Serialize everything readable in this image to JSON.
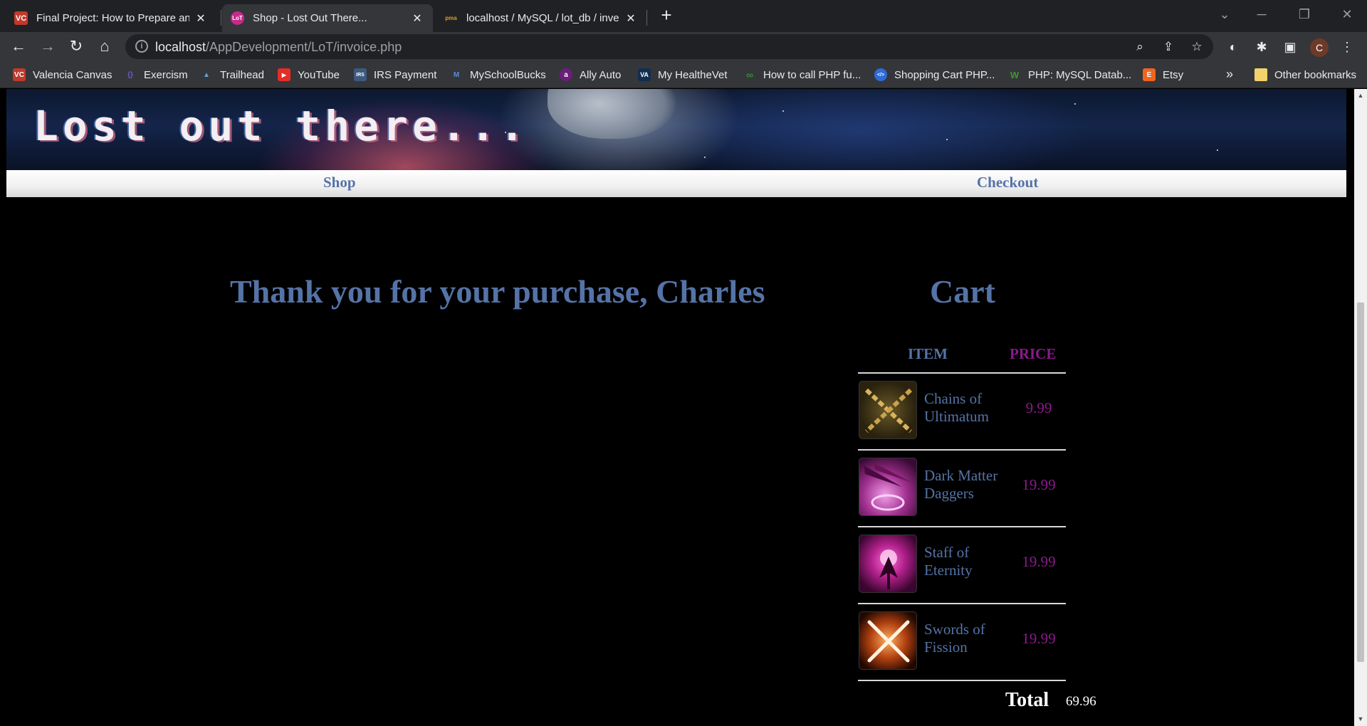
{
  "browser": {
    "tabs": [
      {
        "title": "Final Project: How to Prepare and",
        "favicon": "VC"
      },
      {
        "title": "Shop - Lost Out There...",
        "favicon": "LoT"
      },
      {
        "title": "localhost / MySQL / lot_db / inve",
        "favicon": "pma"
      }
    ],
    "url_host": "localhost",
    "url_path": "/AppDevelopment/LoT/invoice.php",
    "profile_initial": "C",
    "bookmarks": [
      {
        "label": "Valencia Canvas",
        "icon": "VC",
        "color": "#c0392b"
      },
      {
        "label": "Exercism",
        "icon": "{}",
        "color": "#3d2a8a"
      },
      {
        "label": "Trailhead",
        "icon": "▲",
        "color": "#1b73b8"
      },
      {
        "label": "YouTube",
        "icon": "▶",
        "color": "#e52d27"
      },
      {
        "label": "IRS Payment",
        "icon": "IRS",
        "color": "#3d5a80"
      },
      {
        "label": "MySchoolBucks",
        "icon": "M",
        "color": "#2a4d9b"
      },
      {
        "label": "Ally Auto",
        "icon": "a",
        "color": "#6b1e7a"
      },
      {
        "label": "My HealtheVet",
        "icon": "VA",
        "color": "#112e51"
      },
      {
        "label": "How to call PHP fu...",
        "icon": "∞",
        "color": "#3a8a3a"
      },
      {
        "label": "Shopping Cart PHP...",
        "icon": "</>",
        "color": "#2f6bd8"
      },
      {
        "label": "PHP: MySQL Datab...",
        "icon": "W",
        "color": "#3a7a2a"
      },
      {
        "label": "Etsy",
        "icon": "E",
        "color": "#f1641e"
      }
    ],
    "bookmarks_overflow": "»",
    "other_bookmarks": "Other bookmarks"
  },
  "site": {
    "banner_title": "Lost out there...",
    "nav": {
      "shop": "Shop",
      "checkout": "Checkout"
    }
  },
  "invoice": {
    "thank_you": "Thank you for your purchase, Charles",
    "cart_title": "Cart",
    "col_item": "ITEM",
    "col_price": "PRICE",
    "items": [
      {
        "name": "Chains of Ultimatum",
        "price": "9.99",
        "icon": "chains-icon"
      },
      {
        "name": "Dark Matter Daggers",
        "price": "19.99",
        "icon": "daggers-icon"
      },
      {
        "name": "Staff of Eternity",
        "price": "19.99",
        "icon": "staff-icon"
      },
      {
        "name": "Swords of Fission",
        "price": "19.99",
        "icon": "swords-icon"
      }
    ],
    "total_label": "Total",
    "total_value": "69.96"
  },
  "colors": {
    "link": "#5573a6",
    "price": "#8b1a8b",
    "background": "#000000"
  }
}
